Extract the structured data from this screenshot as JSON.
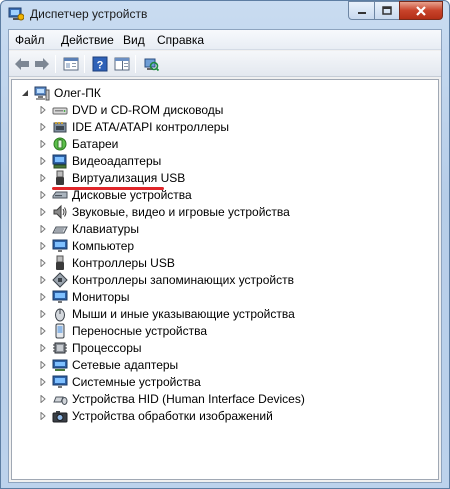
{
  "window": {
    "title": "Диспетчер устройств"
  },
  "menu": {
    "items": [
      {
        "label": "Файл",
        "accel": "Ф"
      },
      {
        "label": "Действие",
        "accel": "Д"
      },
      {
        "label": "Вид",
        "accel": "В"
      },
      {
        "label": "Справка",
        "accel": "С"
      }
    ]
  },
  "toolbar": {
    "buttons": [
      "back-icon",
      "forward-icon",
      "properties-icon",
      "help-icon",
      "show-hide-icon",
      "scan-hardware-icon"
    ]
  },
  "tree": {
    "root": {
      "label": "Олег-ПК",
      "icon": "computer-icon",
      "expanded": true
    },
    "items": [
      {
        "label": "DVD и CD-ROM дисководы",
        "icon": "dvd-drive-icon"
      },
      {
        "label": "IDE ATA/ATAPI контроллеры",
        "icon": "ide-controller-icon"
      },
      {
        "label": "Батареи",
        "icon": "battery-icon"
      },
      {
        "label": "Видеоадаптеры",
        "icon": "display-adapter-icon"
      },
      {
        "label": "Виртуализация USB",
        "icon": "usb-virtualization-icon"
      },
      {
        "label": "Дисковые устройства",
        "icon": "disk-drive-icon"
      },
      {
        "label": "Звуковые, видео и игровые устройства",
        "icon": "sound-icon"
      },
      {
        "label": "Клавиатуры",
        "icon": "keyboard-icon"
      },
      {
        "label": "Компьютер",
        "icon": "monitor-computer-icon"
      },
      {
        "label": "Контроллеры USB",
        "icon": "usb-controller-icon"
      },
      {
        "label": "Контроллеры запоминающих устройств",
        "icon": "storage-controller-icon"
      },
      {
        "label": "Мониторы",
        "icon": "monitor-icon"
      },
      {
        "label": "Мыши и иные указывающие устройства",
        "icon": "mouse-icon"
      },
      {
        "label": "Переносные устройства",
        "icon": "portable-device-icon"
      },
      {
        "label": "Процессоры",
        "icon": "processor-icon"
      },
      {
        "label": "Сетевые адаптеры",
        "icon": "network-adapter-icon"
      },
      {
        "label": "Системные устройства",
        "icon": "system-device-icon"
      },
      {
        "label": "Устройства HID (Human Interface Devices)",
        "icon": "hid-icon"
      },
      {
        "label": "Устройства обработки изображений",
        "icon": "imaging-device-icon"
      }
    ]
  },
  "colors": {
    "highlight": "#e0262a",
    "close_button": "#c8432a"
  }
}
